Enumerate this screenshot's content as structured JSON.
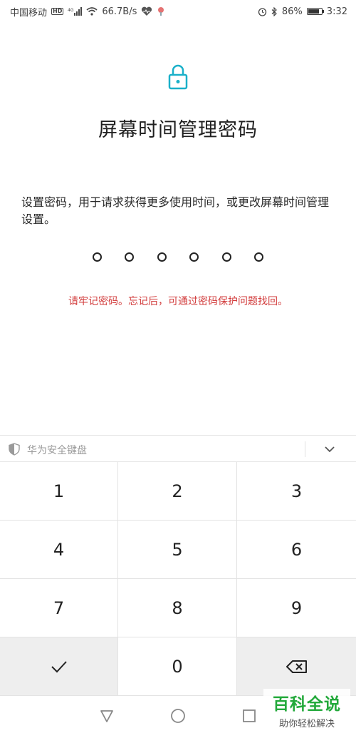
{
  "status_bar": {
    "carrier": "中国移动",
    "hd_badge": "HD",
    "network": "4G",
    "speed": "66.7B/s",
    "battery_percent": "86%",
    "battery_level": 0.86,
    "time": "3:32"
  },
  "page": {
    "title": "屏幕时间管理密码",
    "description": "设置密码，用于请求获得更多使用时间，或更改屏幕时间管理设置。",
    "pin_length": 6,
    "warning": "请牢记密码。忘记后，可通过密码保护问题找回。"
  },
  "keyboard": {
    "title": "华为安全键盘",
    "keys": [
      "1",
      "2",
      "3",
      "4",
      "5",
      "6",
      "7",
      "8",
      "9",
      "",
      "0",
      ""
    ],
    "confirm_icon": "checkmark-icon",
    "delete_icon": "backspace-icon"
  },
  "nav_bar": {
    "back_icon": "back-triangle-icon",
    "home_icon": "home-circle-icon",
    "recents_icon": "recents-square-icon"
  },
  "watermark": {
    "top": "百科全说",
    "bottom": "助你轻松解决"
  },
  "colors": {
    "accent": "#1ab0c9",
    "warning": "#d23c3c",
    "watermark_green": "#23a93b"
  }
}
